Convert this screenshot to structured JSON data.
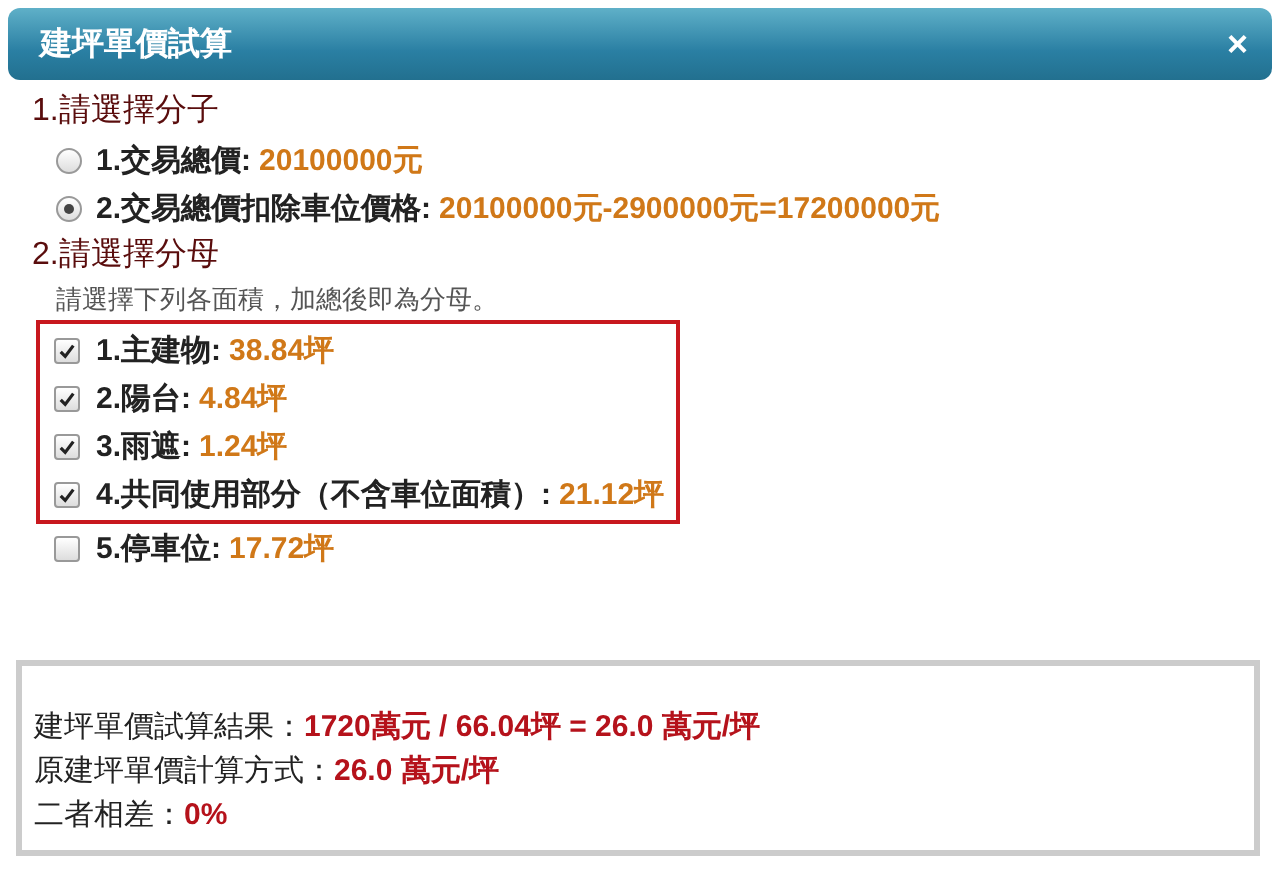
{
  "window": {
    "title": "建坪單價試算",
    "close": "×"
  },
  "numerator": {
    "heading": "1.請選擇分子",
    "options": [
      {
        "label": "1.交易總價:",
        "value": "20100000元",
        "selected": false
      },
      {
        "label": "2.交易總價扣除車位價格:",
        "value": "20100000元-2900000元=17200000元",
        "selected": true
      }
    ]
  },
  "denominator": {
    "heading": "2.請選擇分母",
    "hint": "請選擇下列各面積，加總後即為分母。",
    "items": [
      {
        "label": "1.主建物:",
        "value": "38.84坪",
        "checked": true,
        "highlighted": true
      },
      {
        "label": "2.陽台:",
        "value": "4.84坪",
        "checked": true,
        "highlighted": true
      },
      {
        "label": "3.雨遮:",
        "value": "1.24坪",
        "checked": true,
        "highlighted": true
      },
      {
        "label": "4.共同使用部分（不含車位面積）:",
        "value": "21.12坪",
        "checked": true,
        "highlighted": true
      },
      {
        "label": "5.停車位:",
        "value": "17.72坪",
        "checked": false,
        "highlighted": false
      }
    ]
  },
  "results": [
    {
      "label": "建坪單價試算結果：",
      "value": "1720萬元 / 66.04坪 = 26.0 萬元/坪"
    },
    {
      "label": "原建坪單價計算方式：",
      "value": "26.0 萬元/坪"
    },
    {
      "label": "二者相差：",
      "value": "0%"
    }
  ]
}
